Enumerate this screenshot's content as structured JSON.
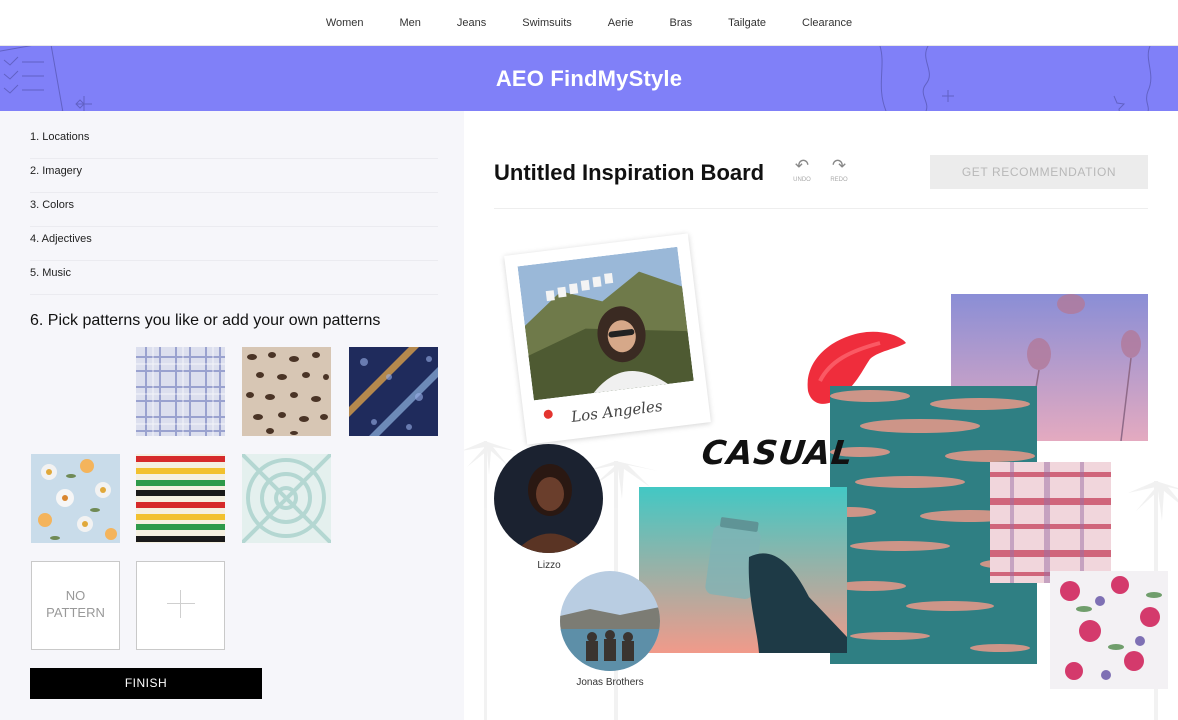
{
  "nav": {
    "items": [
      "Women",
      "Men",
      "Jeans",
      "Swimsuits",
      "Aerie",
      "Bras",
      "Tailgate",
      "Clearance"
    ]
  },
  "banner": {
    "title": "AEO FindMyStyle"
  },
  "steps": [
    {
      "label": "1. Locations"
    },
    {
      "label": "2. Imagery"
    },
    {
      "label": "3. Colors"
    },
    {
      "label": "4. Adjectives"
    },
    {
      "label": "5. Music"
    }
  ],
  "current_step": {
    "label": "6. Pick patterns you like or add your own patterns"
  },
  "patterns": [
    {
      "name": "plaid-pattern"
    },
    {
      "name": "leopard-pattern"
    },
    {
      "name": "bandana-pattern"
    },
    {
      "name": "floral-pattern"
    },
    {
      "name": "rainbow-stripe-pattern"
    },
    {
      "name": "tie-dye-pattern"
    }
  ],
  "no_pattern": {
    "line1": "NO",
    "line2": "PATTERN"
  },
  "finish_label": "FINISH",
  "board": {
    "title": "Untitled Inspiration Board",
    "undo_label": "UNDO",
    "redo_label": "REDO",
    "get_recommendation_label": "GET RECOMMENDATION",
    "polaroid_caption": "Los Angeles",
    "sticker_text": "CASUAL",
    "artists": [
      {
        "label": "Lizzo"
      },
      {
        "label": "Jonas Brothers"
      }
    ]
  },
  "icons": {
    "undo": "undo-icon",
    "redo": "redo-icon",
    "plus": "plus-icon",
    "pin": "location-pin-icon"
  },
  "colors": {
    "banner": "#8080f8",
    "finish_bg": "#000000",
    "get_rec_bg": "#ececec"
  }
}
